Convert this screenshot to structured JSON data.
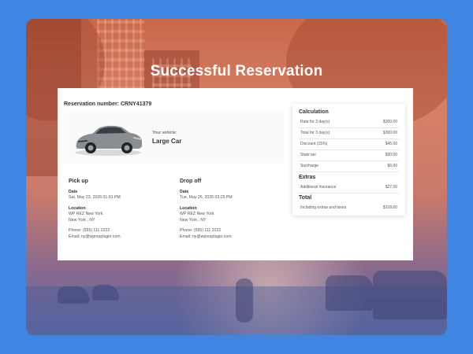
{
  "page": {
    "title": "Successful Reservation"
  },
  "reservation": {
    "number_label": "Reservation number:",
    "number": "CRNY41379"
  },
  "vehicle": {
    "label": "Your vehicle:",
    "name": "Large Car"
  },
  "pickup": {
    "title": "Pick up",
    "date_label": "Date",
    "date": "Sat, May 23, 2026 01:01 PM",
    "location_label": "Location",
    "location_line1": "WP REZ New York",
    "location_line2": "New York , NY",
    "phone": "Phone: (555) 111 2222",
    "email": "Email: ny@wprezplugin.com"
  },
  "dropoff": {
    "title": "Drop off",
    "date_label": "Date",
    "date": "Tue, May 26, 2026 03:25 PM",
    "location_label": "Location",
    "location_line1": "WP REZ New York",
    "location_line2": "New York , NY",
    "phone": "Phone: (555) 111 2222",
    "email": "Email: ny@wprezplugin.com"
  },
  "calculation": {
    "title": "Calculation",
    "rows": [
      {
        "label": "Rate for 3 day(s)",
        "value": "$300.00"
      },
      {
        "label": "Total for 3 day(s)",
        "value": "$300.00"
      },
      {
        "label": "Discount (15%)",
        "value": "$45.00"
      },
      {
        "label": "State tax",
        "value": "$30.00"
      },
      {
        "label": "Surcharge",
        "value": "$6.00"
      }
    ],
    "extras_title": "Extras",
    "extras": [
      {
        "label": "Additional Insurance",
        "value": "$27.00"
      }
    ],
    "total_title": "Total",
    "total_row": {
      "label": "Including extras and taxes",
      "value": "$318.00"
    }
  },
  "colors": {
    "background": "#3f86e3",
    "card": "#ffffff",
    "text": "#333333"
  }
}
